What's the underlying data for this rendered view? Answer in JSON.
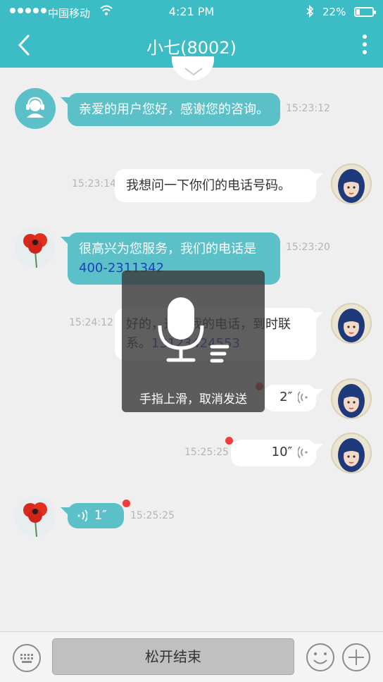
{
  "status_bar": {
    "carrier": "中国移动",
    "time": "4:21 PM",
    "battery": "22%"
  },
  "header": {
    "title": "小七(8002)"
  },
  "messages": [
    {
      "side": "left",
      "text": "亲爱的用户您好，感谢您的咨询。",
      "time": "15:23:12"
    },
    {
      "side": "right",
      "text": "我想问一下你们的电话号码。",
      "time": "15:23:14"
    },
    {
      "side": "left",
      "text": "很高兴为您服务，我们的电话是 ",
      "phone": "400-2311342",
      "time": "15:23:20"
    },
    {
      "side": "right",
      "text": "好的，这是我的电话，到时联系。",
      "phone": "13123424553",
      "time": "15:24:12"
    },
    {
      "side": "right",
      "voice": "2″",
      "time": ""
    },
    {
      "side": "right",
      "voice": "10″",
      "time": "15:25:25"
    },
    {
      "side": "left",
      "voice": "1″",
      "time": "15:25:25"
    }
  ],
  "voice_overlay": {
    "hint": "手指上滑，取消发送"
  },
  "bottom_bar": {
    "release_label": "松开结束"
  },
  "colors": {
    "accent": "#3cbcc4",
    "bubble_left": "#5cc0c8",
    "unread_dot": "#f03c3c"
  }
}
